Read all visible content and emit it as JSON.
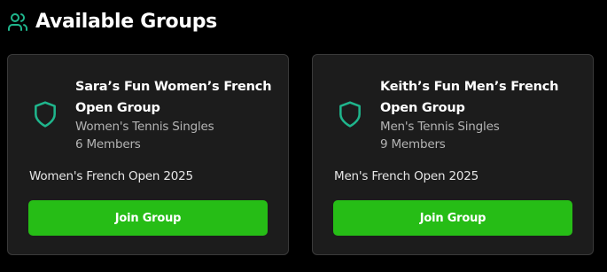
{
  "header": {
    "icon": "users-icon",
    "title": "Available Groups"
  },
  "colors": {
    "accent_icon": "#1fb58c",
    "join_button": "#26bd16",
    "card_bg": "#1c1c1c",
    "card_border": "#3a3a3a",
    "muted_text": "#b4b4b4"
  },
  "groups": [
    {
      "icon": "shield-icon",
      "name": "Sara’s Fun Women’s French Open Group",
      "type": "Women's Tennis Singles",
      "members": "6 Members",
      "event": "Women's French Open 2025",
      "button_label": "Join Group"
    },
    {
      "icon": "shield-icon",
      "name": "Keith’s Fun Men’s French Open Group",
      "type": "Men's Tennis Singles",
      "members": "9 Members",
      "event": "Men's French Open 2025",
      "button_label": "Join Group"
    }
  ]
}
